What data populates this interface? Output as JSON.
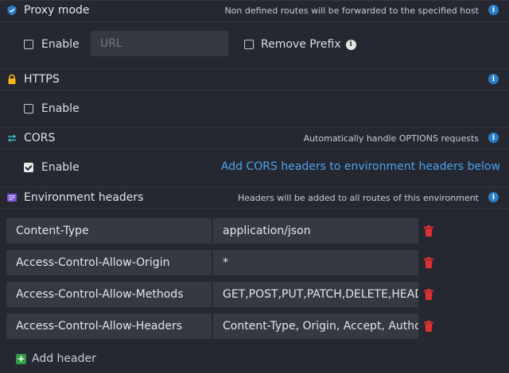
{
  "proxy": {
    "title": "Proxy mode",
    "hint": "Non defined routes will be forwarded to the specified host",
    "enable_label": "Enable",
    "url_placeholder": "URL",
    "remove_prefix_label": "Remove Prefix"
  },
  "https": {
    "title": "HTTPS",
    "enable_label": "Enable"
  },
  "cors": {
    "title": "CORS",
    "hint": "Automatically handle OPTIONS requests",
    "enable_label": "Enable",
    "add_link": "Add CORS headers to environment headers below"
  },
  "env_headers": {
    "title": "Environment headers",
    "hint": "Headers will be added to all routes of this environment",
    "rows": [
      {
        "key": "Content-Type",
        "value": "application/json"
      },
      {
        "key": "Access-Control-Allow-Origin",
        "value": "*"
      },
      {
        "key": "Access-Control-Allow-Methods",
        "value": "GET,POST,PUT,PATCH,DELETE,HEAD,OPTIONS"
      },
      {
        "key": "Access-Control-Allow-Headers",
        "value": "Content-Type, Origin, Accept, Authorization, Content-Length, X-Requested-With"
      }
    ],
    "add_header_label": "Add header"
  },
  "colors": {
    "background": "#252830",
    "input_bg": "#363941",
    "link": "#4aa3ef",
    "info": "#2a7ec8",
    "delete": "#e03131",
    "add": "#2f9e44"
  },
  "icons": {
    "proxy": "shield-icon",
    "https": "lock-icon",
    "cors": "arrows-exchange-icon",
    "headers": "list-icon",
    "info": "info-icon",
    "delete": "trash-icon",
    "add": "plus-icon"
  }
}
